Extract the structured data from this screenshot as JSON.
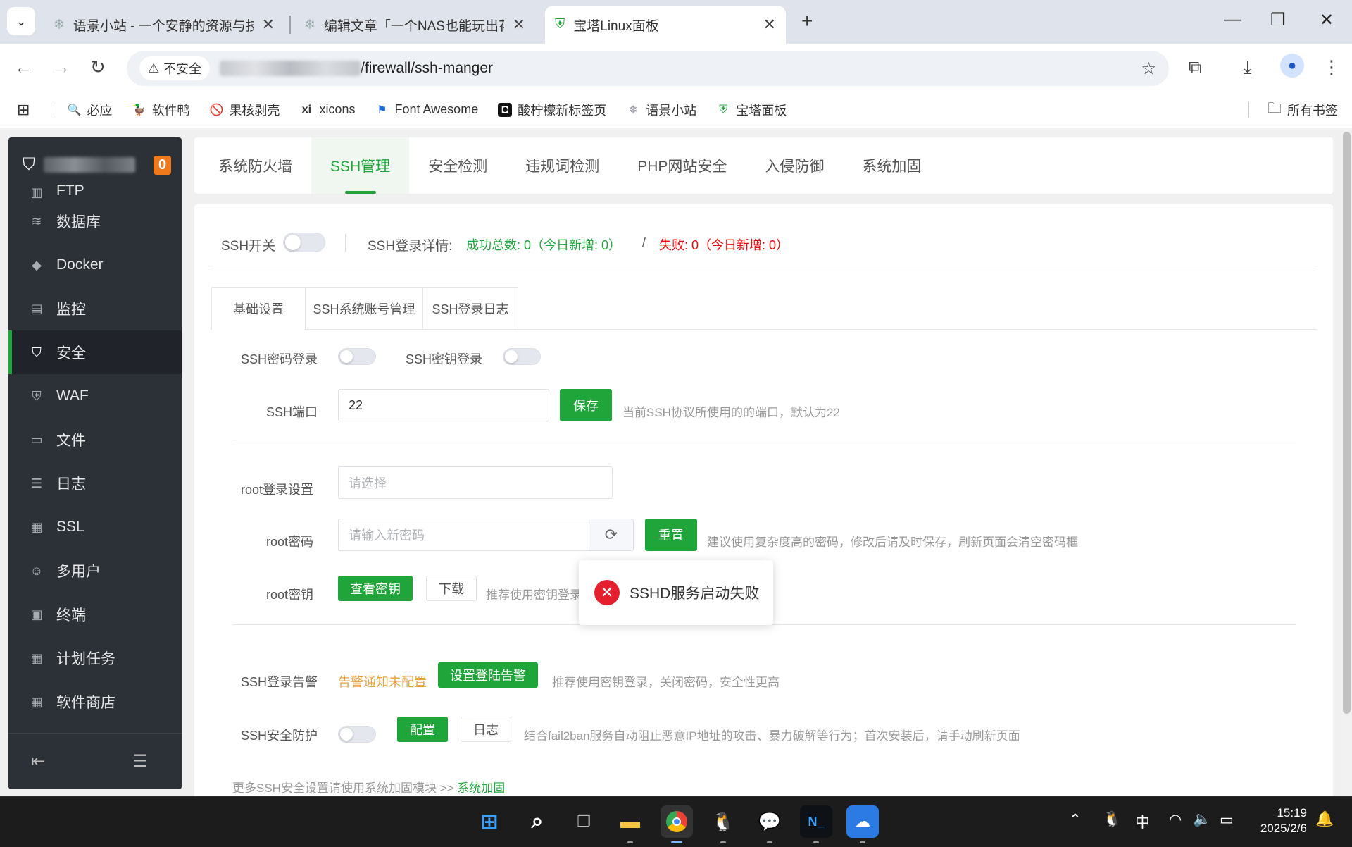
{
  "browser": {
    "tabs": [
      {
        "title": "语景小站 - 一个安静的资源与技",
        "active": false
      },
      {
        "title": "编辑文章「一个NAS也能玩出花",
        "active": false
      },
      {
        "title": "宝塔Linux面板",
        "active": true
      }
    ],
    "new_tab": "+",
    "security_label": "不安全",
    "url_path": "/firewall/ssh-manger",
    "bookmarks": [
      "必应",
      "软件鸭",
      "果核剥壳",
      "xicons",
      "Font Awesome",
      "酸柠檬新标签页",
      "语景小站",
      "宝塔面板"
    ],
    "bookmark_icons": [
      "🔍",
      "🦆",
      "🚫",
      "xi",
      "⚑",
      "◘",
      "❄",
      "⛨"
    ],
    "all_bookmarks": "所有书签"
  },
  "sidebar": {
    "badge": "0",
    "partial_item": "FTP",
    "items": [
      {
        "label": "数据库",
        "icon": "database-icon",
        "glyph": "≋"
      },
      {
        "label": "Docker",
        "icon": "docker-icon",
        "glyph": "◆"
      },
      {
        "label": "监控",
        "icon": "monitor-icon",
        "glyph": "▤"
      },
      {
        "label": "安全",
        "icon": "shield-icon",
        "glyph": "⛉",
        "active": true
      },
      {
        "label": "WAF",
        "icon": "waf-icon",
        "glyph": "⛨"
      },
      {
        "label": "文件",
        "icon": "folder-icon",
        "glyph": "▭"
      },
      {
        "label": "日志",
        "icon": "log-icon",
        "glyph": "☰"
      },
      {
        "label": "SSL",
        "icon": "ssl-icon",
        "glyph": "▦"
      },
      {
        "label": "多用户",
        "icon": "users-icon",
        "glyph": "☺"
      },
      {
        "label": "终端",
        "icon": "terminal-icon",
        "glyph": "▣"
      },
      {
        "label": "计划任务",
        "icon": "calendar-icon",
        "glyph": "▦"
      },
      {
        "label": "软件商店",
        "icon": "store-icon",
        "glyph": "▦"
      }
    ]
  },
  "topnav": [
    "系统防火墙",
    "SSH管理",
    "安全检测",
    "违规词检测",
    "PHP网站安全",
    "入侵防御",
    "系统加固"
  ],
  "ssh": {
    "switch_label": "SSH开关",
    "detail_label": "SSH登录详情:",
    "success_text": "成功总数: 0（今日新增: 0）",
    "sep": "/",
    "fail_text": "失败: 0（今日新增: 0）",
    "subtabs": [
      "基础设置",
      "SSH系统账号管理",
      "SSH登录日志"
    ],
    "pwd_login": "SSH密码登录",
    "key_login": "SSH密钥登录",
    "port_label": "SSH端口",
    "port_value": "22",
    "save": "保存",
    "port_hint": "当前SSH协议所使用的的端口，默认为22",
    "root_login_label": "root登录设置",
    "root_login_placeholder": "请选择",
    "root_pwd_label": "root密码",
    "root_pwd_placeholder": "请输入新密码",
    "reset": "重置",
    "root_pwd_hint": "建议使用复杂度高的密码，修改后请及时保存，刷新页面会清空密码框",
    "root_key_label": "root密钥",
    "view_key": "查看密钥",
    "download": "下载",
    "root_key_hint": "推荐使用密钥登录，关闭密码，安全性更高",
    "alert_label": "SSH登录告警",
    "alert_status": "告警通知未配置",
    "alert_btn": "设置登陆告警",
    "alert_hint": "推荐使用密钥登录，关闭密码，安全性更高",
    "protect_label": "SSH安全防护",
    "config": "配置",
    "log": "日志",
    "protect_hint": "结合fail2ban服务自动阻止恶意IP地址的攻击、暴力破解等行为；首次安装后，请手动刷新页面",
    "more_text": "更多SSH安全设置请使用系统加固模块 >>",
    "more_link": "系统加固"
  },
  "toast": {
    "message": "SSHD服务启动失败"
  },
  "taskbar": {
    "ime": "中",
    "time": "15:19",
    "date": "2025/2/6"
  },
  "colors": {
    "accent": "#20a53a",
    "danger": "#e5202e",
    "warning": "#e6a23c"
  }
}
